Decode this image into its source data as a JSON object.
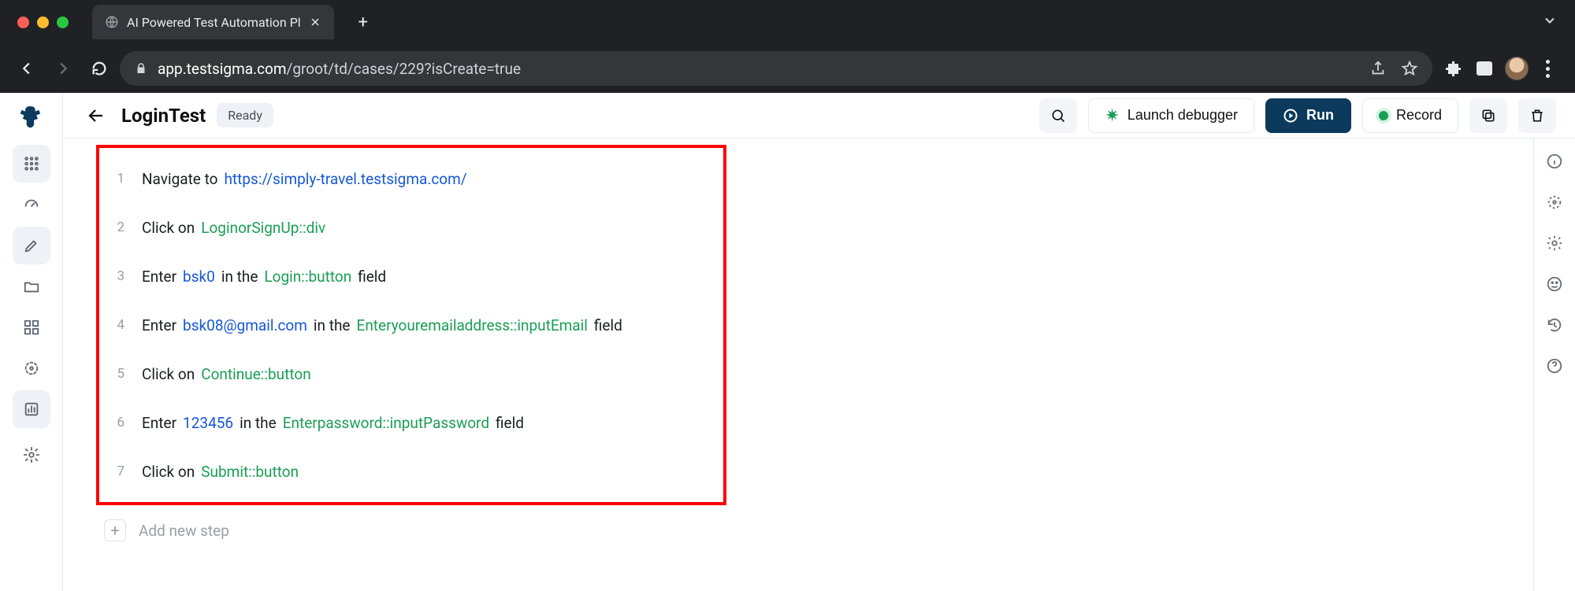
{
  "browser": {
    "tab_title": "AI Powered Test Automation Pl",
    "url_host": "app.testsigma.com",
    "url_path": "/groot/td/cases/229?isCreate=true"
  },
  "header": {
    "title": "LoginTest",
    "status": "Ready",
    "launch_debugger_label": "Launch debugger",
    "run_label": "Run",
    "record_label": "Record"
  },
  "steps": [
    {
      "num": "1",
      "parts": [
        {
          "t": "Navigate to",
          "cls": ""
        },
        {
          "t": "https://simply-travel.testsigma.com/",
          "cls": "token-link"
        }
      ]
    },
    {
      "num": "2",
      "parts": [
        {
          "t": "Click on",
          "cls": ""
        },
        {
          "t": "LoginorSignUp::div",
          "cls": "token-elem"
        }
      ]
    },
    {
      "num": "3",
      "parts": [
        {
          "t": "Enter",
          "cls": ""
        },
        {
          "t": "bsk0",
          "cls": "token-val"
        },
        {
          "t": "in the",
          "cls": ""
        },
        {
          "t": "Login::button",
          "cls": "token-elem"
        },
        {
          "t": "field",
          "cls": ""
        }
      ]
    },
    {
      "num": "4",
      "parts": [
        {
          "t": "Enter",
          "cls": ""
        },
        {
          "t": "bsk08@gmail.com",
          "cls": "token-val"
        },
        {
          "t": "in the",
          "cls": ""
        },
        {
          "t": "Enteryouremailaddress::inputEmail",
          "cls": "token-elem"
        },
        {
          "t": "field",
          "cls": ""
        }
      ]
    },
    {
      "num": "5",
      "parts": [
        {
          "t": "Click on",
          "cls": ""
        },
        {
          "t": "Continue::button",
          "cls": "token-elem"
        }
      ]
    },
    {
      "num": "6",
      "parts": [
        {
          "t": "Enter",
          "cls": ""
        },
        {
          "t": "123456",
          "cls": "token-val"
        },
        {
          "t": "in the",
          "cls": ""
        },
        {
          "t": "Enterpassword::inputPassword",
          "cls": "token-elem"
        },
        {
          "t": "field",
          "cls": ""
        }
      ]
    },
    {
      "num": "7",
      "parts": [
        {
          "t": "Click on",
          "cls": ""
        },
        {
          "t": "Submit::button",
          "cls": "token-elem"
        }
      ]
    }
  ],
  "add_step_label": "Add new step"
}
